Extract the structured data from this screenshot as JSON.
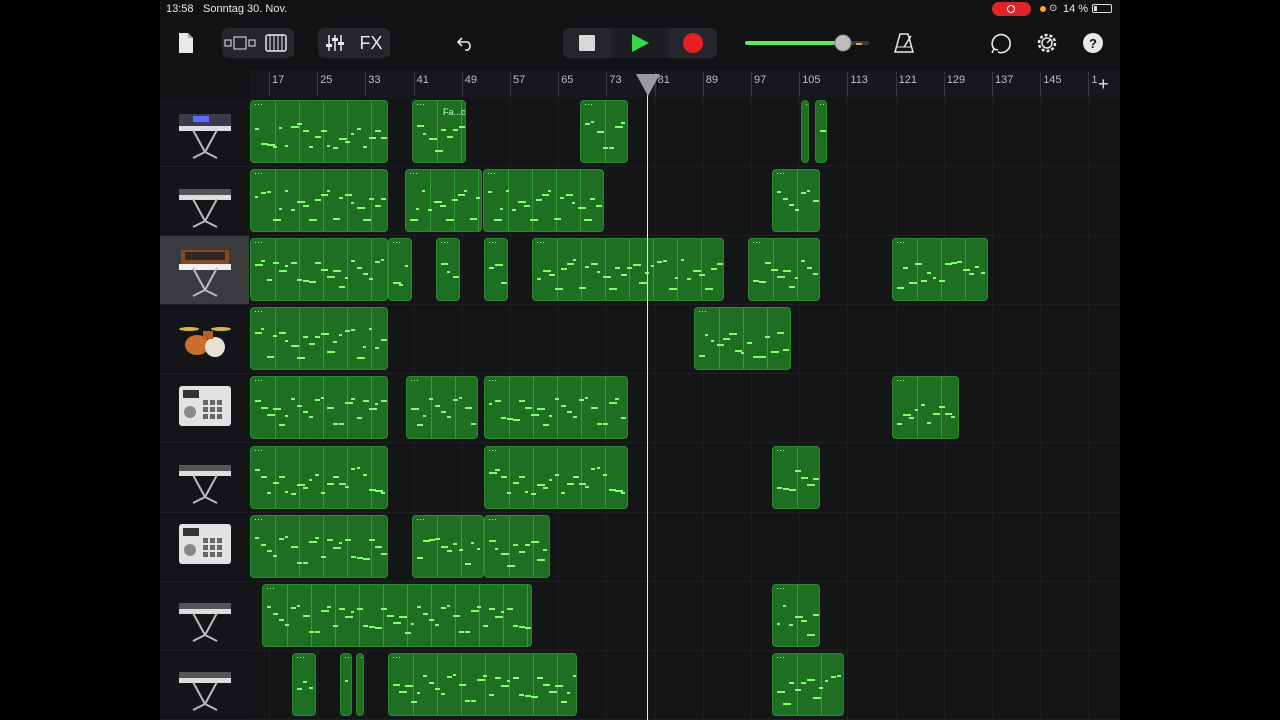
{
  "status": {
    "time": "13:58",
    "date": "Sonntag 30. Nov.",
    "battery": "14 %"
  },
  "toolbar": {
    "fx_label": "FX",
    "volume_level": 0.79,
    "colors": {
      "play": "#36d94a",
      "record": "#e51f23",
      "accent_green": "#5ee85a"
    }
  },
  "ruler": {
    "bars": [
      "17",
      "25",
      "33",
      "41",
      "49",
      "57",
      "65",
      "73",
      "81",
      "89",
      "97",
      "105",
      "113",
      "121",
      "129",
      "137",
      "145",
      "1"
    ]
  },
  "tracks": [
    {
      "instrument": "synth-workstation-icon",
      "regions": [
        {
          "label": "Fa...ox"
        }
      ]
    },
    {
      "instrument": "keyboard-on-stand-icon"
    },
    {
      "instrument": "analog-synth-icon",
      "selected": true
    },
    {
      "instrument": "drum-kit-icon"
    },
    {
      "instrument": "beat-sampler-icon"
    },
    {
      "instrument": "keyboard-on-stand-icon"
    },
    {
      "instrument": "beat-sampler-icon"
    },
    {
      "instrument": "keyboard-on-stand-icon"
    },
    {
      "instrument": "keyboard-on-stand-icon"
    }
  ]
}
